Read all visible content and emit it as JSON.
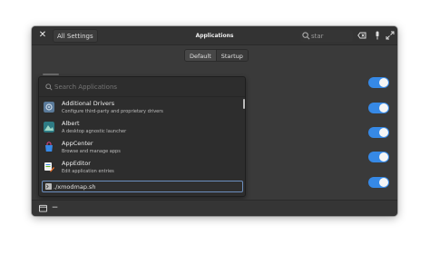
{
  "window": {
    "close_glyph": "✕",
    "back_label": "All Settings",
    "title": "Applications",
    "search": {
      "value": "star",
      "icon": "search-icon"
    }
  },
  "mode_tabs": [
    {
      "label": "Default",
      "active": true
    },
    {
      "label": "Startup",
      "active": false
    }
  ],
  "toggles": [
    true,
    true,
    true,
    true,
    true
  ],
  "popover": {
    "search_placeholder": "Search Applications",
    "apps": [
      {
        "name": "Additional Drivers",
        "description": "Configure third-party and proprietary drivers",
        "icon": "drivers-icon"
      },
      {
        "name": "Albert",
        "description": "A desktop agnostic launcher",
        "icon": "albert-icon"
      },
      {
        "name": "AppCenter",
        "description": "Browse and manage apps",
        "icon": "appcenter-icon"
      },
      {
        "name": "AppEditor",
        "description": "Edit application entries",
        "icon": "appeditor-icon"
      }
    ],
    "command_value": "./xmodmap.sh"
  },
  "bottombar": {
    "remove_glyph": "−"
  },
  "colors": {
    "accent": "#3689e6",
    "window_bg": "#3a3a3a",
    "popover_bg": "#2d2d2d"
  }
}
